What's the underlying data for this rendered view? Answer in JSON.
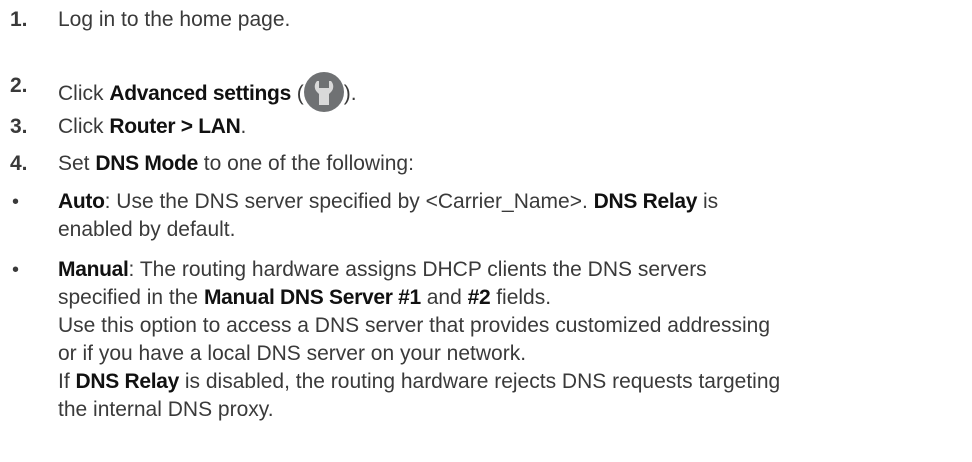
{
  "steps": [
    {
      "num": "1.",
      "text": "Log in to the home page."
    },
    {
      "num": "2.",
      "pre": "Click ",
      "bold": "Advanced settings",
      "mid": " (",
      "post": ")."
    },
    {
      "num": "3.",
      "pre": "Click ",
      "bold": "Router > LAN",
      "post": "."
    },
    {
      "num": "4.",
      "pre": "Set ",
      "bold": "DNS Mode",
      "post": " to one of the following:"
    }
  ],
  "bullets": [
    {
      "bullet": "•",
      "auto_label": "Auto",
      "auto_text": ": Use the DNS server specified by <Carrier_Name>. ",
      "relay_label": "DNS Relay",
      "relay_tail": " is",
      "line2": "enabled by default."
    },
    {
      "bullet": "•",
      "manual_label": "Manual",
      "manual_text": ": The routing hardware assigns DHCP clients the DNS servers",
      "l2_pre": "specified in the ",
      "l2_bold1": "Manual DNS Server #1",
      "l2_and": " and ",
      "l2_bold2": "#2",
      "l2_post": " fields.",
      "l3": "Use this option to access a DNS server that provides customized addressing",
      "l4": "or if you have a local DNS server on your network.",
      "l5_pre": "If ",
      "l5_bold": "DNS Relay",
      "l5_post": " is disabled, the routing hardware rejects DNS requests targeting",
      "l6": "the internal DNS proxy."
    }
  ],
  "icon": {
    "name": "wrench-icon",
    "color": "#6f7173"
  }
}
